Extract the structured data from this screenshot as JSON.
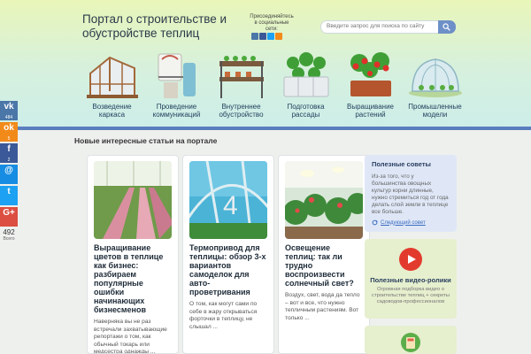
{
  "header": {
    "site_title": "Портал о строительстве и обустройстве теплиц",
    "social_join": "Присоединяйтесь в социальные сети:",
    "search_placeholder": "Введите запрос для поиска по сайту",
    "nav": [
      {
        "label": "Возведение каркаса",
        "icon": "greenhouse-frame-icon"
      },
      {
        "label": "Проведение коммуникаций",
        "icon": "water-tank-icon"
      },
      {
        "label": "Внутреннее обустройство",
        "icon": "shelving-icon"
      },
      {
        "label": "Подготовка рассады",
        "icon": "seedlings-icon"
      },
      {
        "label": "Выращивание растений",
        "icon": "tomato-plants-icon"
      },
      {
        "label": "Промышленные модели",
        "icon": "arched-greenhouse-icon"
      }
    ]
  },
  "social_sidebar": {
    "buttons": [
      {
        "name": "vk",
        "glyph": "vk",
        "count": "484",
        "color": "#4a76a8"
      },
      {
        "name": "odnoklassniki",
        "glyph": "ok",
        "count": "5",
        "color": "#f28a1a"
      },
      {
        "name": "facebook",
        "glyph": "f",
        "count": "2",
        "color": "#3b5998"
      },
      {
        "name": "mail",
        "glyph": "@",
        "count": "",
        "color": "#168de2"
      },
      {
        "name": "twitter",
        "glyph": "t",
        "count": "",
        "color": "#1da1f2"
      },
      {
        "name": "google-plus",
        "glyph": "G+",
        "count": "",
        "color": "#dc4e41"
      }
    ],
    "total": "492",
    "total_label": "Всего"
  },
  "main": {
    "section_title": "Новые интересные статьи на портале",
    "articles": [
      {
        "title": "Выращивание цветов в теплице как бизнес: разбираем популярные ошибки начинающих бизнесменов",
        "excerpt": "Наверняка вы не раз встречали захватывающие репортажи о том, как обычный токарь или медсестра однажды ..."
      },
      {
        "title": "Термопривод для теплицы: обзор 3-х вариантов самоделок для авто-проветривания",
        "excerpt": "О том, как могут сами по себе в жару открываться форточки в теплицу, не слышал ..."
      },
      {
        "title": "Освещение теплиц: так ли трудно воспроизвести солнечный свет?",
        "excerpt": "Воздух, свет, вода да тепло – вот и все, что нужно тепличным растениям. Вот только ..."
      }
    ]
  },
  "sidebar": {
    "tips": {
      "title": "Полезные советы",
      "text": "Из-за того, что у большинства овощных культур корни длинные, нужно стремиться год от года делать слой земли в теплице все больше.",
      "next_label": "Следующий совет"
    },
    "videos": {
      "title": "Полезные видео-ролики",
      "text": "Огромная подборка видео о строительстве теплиц + секреты садоводов-профессионалов"
    }
  },
  "colors": {
    "accent": "#5a7ebd",
    "link": "#3b6cc0"
  }
}
